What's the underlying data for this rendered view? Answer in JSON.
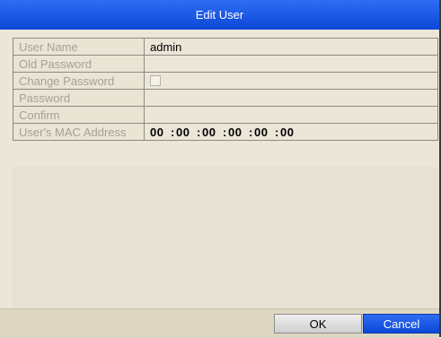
{
  "dialog": {
    "title": "Edit User"
  },
  "fields": {
    "user_name": {
      "label": "User Name",
      "value": "admin"
    },
    "old_password": {
      "label": "Old Password",
      "value": ""
    },
    "change_password": {
      "label": "Change Password",
      "checked": false
    },
    "password": {
      "label": "Password",
      "value": ""
    },
    "confirm": {
      "label": "Confirm",
      "value": ""
    },
    "mac_address": {
      "label": "User's MAC Address",
      "segments": [
        "00",
        "00",
        "00",
        "00",
        "00",
        "00"
      ],
      "separator": ":"
    }
  },
  "buttons": {
    "ok": "OK",
    "cancel": "Cancel"
  },
  "colors": {
    "title_bar": "#1f5ce6",
    "cancel_button": "#1f5ce6",
    "panel": "#ebe6d8",
    "label_text": "#a7a194"
  }
}
